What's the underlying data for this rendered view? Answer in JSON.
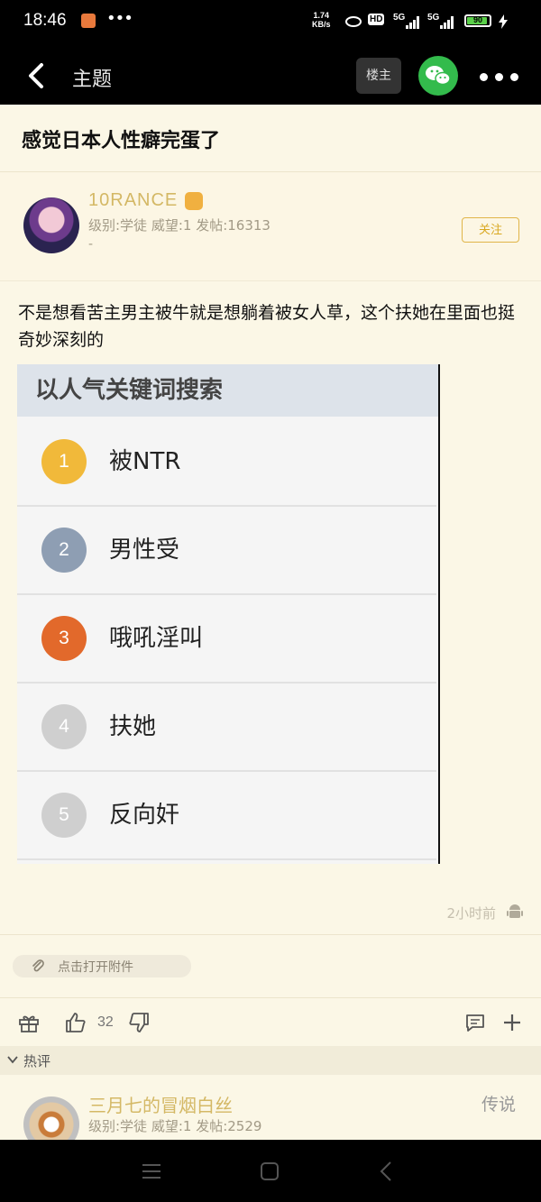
{
  "status_bar": {
    "time": "18:46",
    "net_speed_value": "1.74",
    "net_speed_unit": "KB/s",
    "hd_label": "HD",
    "signal1": "5G",
    "signal2": "5G",
    "battery": "90",
    "battery_fraction": 0.9
  },
  "nav": {
    "title": "主题",
    "owner_label": "楼主"
  },
  "post": {
    "title": "感觉日本人性癖完蛋了",
    "author": {
      "name": "10RANCE",
      "meta": "级别:学徒 威望:1 发帖:16313",
      "extra": "-",
      "follow_label": "关注"
    },
    "body": "不是想看苦主男主被牛就是想躺着被女人草，这个扶她在里面也挺奇妙深刻的",
    "image": {
      "header": "以人气关键词搜索",
      "items": [
        {
          "rank": "1",
          "label": "被NTR",
          "color": "#f1b93a"
        },
        {
          "rank": "2",
          "label": "男性受",
          "color": "#8e9eb3"
        },
        {
          "rank": "3",
          "label": "哦吼淫叫",
          "color": "#e2692b"
        },
        {
          "rank": "4",
          "label": "扶她",
          "color": "#cfcfcf"
        },
        {
          "rank": "5",
          "label": "反向奸",
          "color": "#cfcfcf"
        }
      ]
    },
    "time": "2小时前",
    "attachment_label": "点击打开附件",
    "like_count": "32"
  },
  "hot_comments": {
    "label": "热评",
    "first": {
      "name": "三月七的冒烟白丝",
      "meta": "级别:学徒 威望:1 发帖:2529",
      "rank": "传说"
    }
  }
}
